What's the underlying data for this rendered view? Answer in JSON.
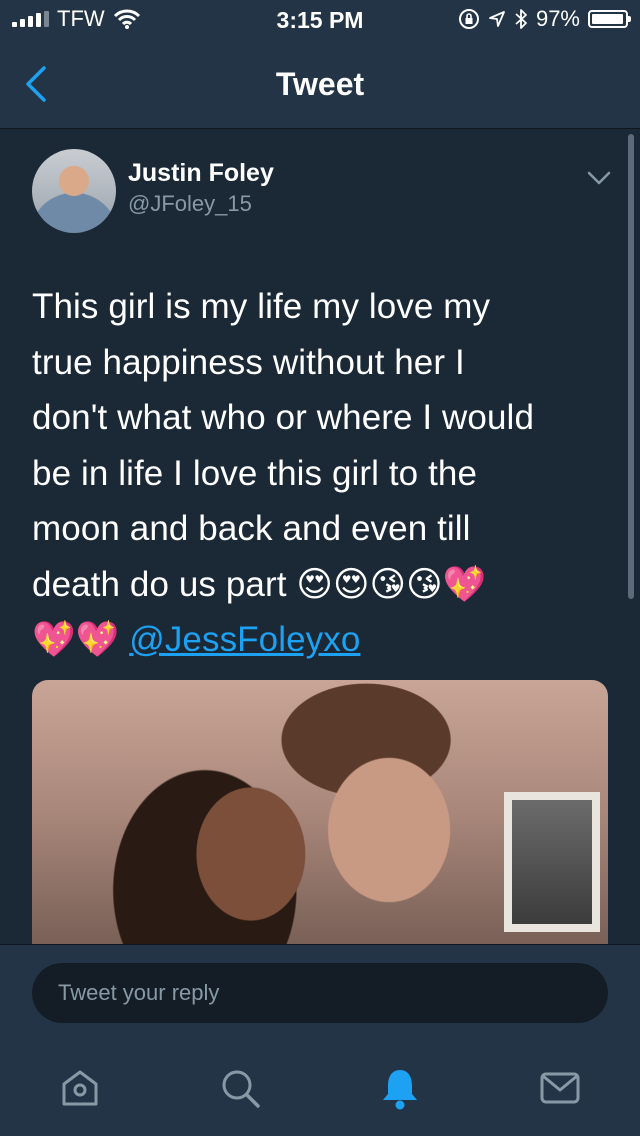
{
  "status_bar": {
    "carrier": "TFW",
    "time": "3:15 PM",
    "battery_percent": "97%",
    "battery_level": 0.97
  },
  "nav": {
    "title": "Tweet"
  },
  "tweet": {
    "author_name": "Justin Foley",
    "author_handle": "@JFoley_15",
    "text_line1": "This girl is my life my love my",
    "text_line2": "true happiness without her I",
    "text_line3": "don't what who or where I would",
    "text_line4": "be in life I love this girl to the",
    "text_line5": "moon and back and even till",
    "text_line6": "death do us part 😍😍😘😘💖",
    "text_line7": "💖💖",
    "mention": "@JessFoleyxo"
  },
  "reply": {
    "placeholder": "Tweet your reply"
  },
  "tabs": [
    "home-icon",
    "search-icon",
    "notifications-icon",
    "messages-icon"
  ],
  "colors": {
    "accent": "#1da1f2",
    "background": "#141d26",
    "bar": "#243447",
    "secondary_text": "#8899a6"
  }
}
